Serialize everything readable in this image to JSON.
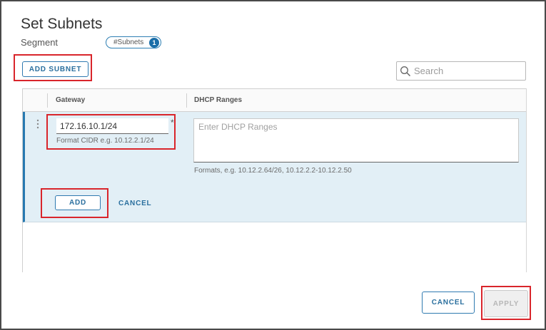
{
  "dialog": {
    "title": "Set Subnets",
    "segment_label": "Segment",
    "subnets_tag": "#Subnets",
    "subnets_count": "1"
  },
  "toolbar": {
    "add_subnet_label": "ADD SUBNET",
    "search_placeholder": "Search"
  },
  "grid": {
    "columns": [
      "Gateway",
      "DHCP Ranges"
    ]
  },
  "edit_row": {
    "gateway_value": "172.16.10.1/24",
    "gateway_required": "*",
    "gateway_helper": "Format CIDR e.g. 10.12.2.1/24",
    "dhcp_placeholder": "Enter DHCP Ranges",
    "dhcp_helper": "Formats, e.g. 10.12.2.64/26, 10.12.2.2-10.12.2.50",
    "add_label": "ADD",
    "cancel_label": "CANCEL"
  },
  "footer": {
    "cancel_label": "CANCEL",
    "apply_label": "APPLY"
  },
  "colors": {
    "accent": "#2a6f9e",
    "highlight": "#d9252b",
    "row_bg": "#e2eff6"
  }
}
